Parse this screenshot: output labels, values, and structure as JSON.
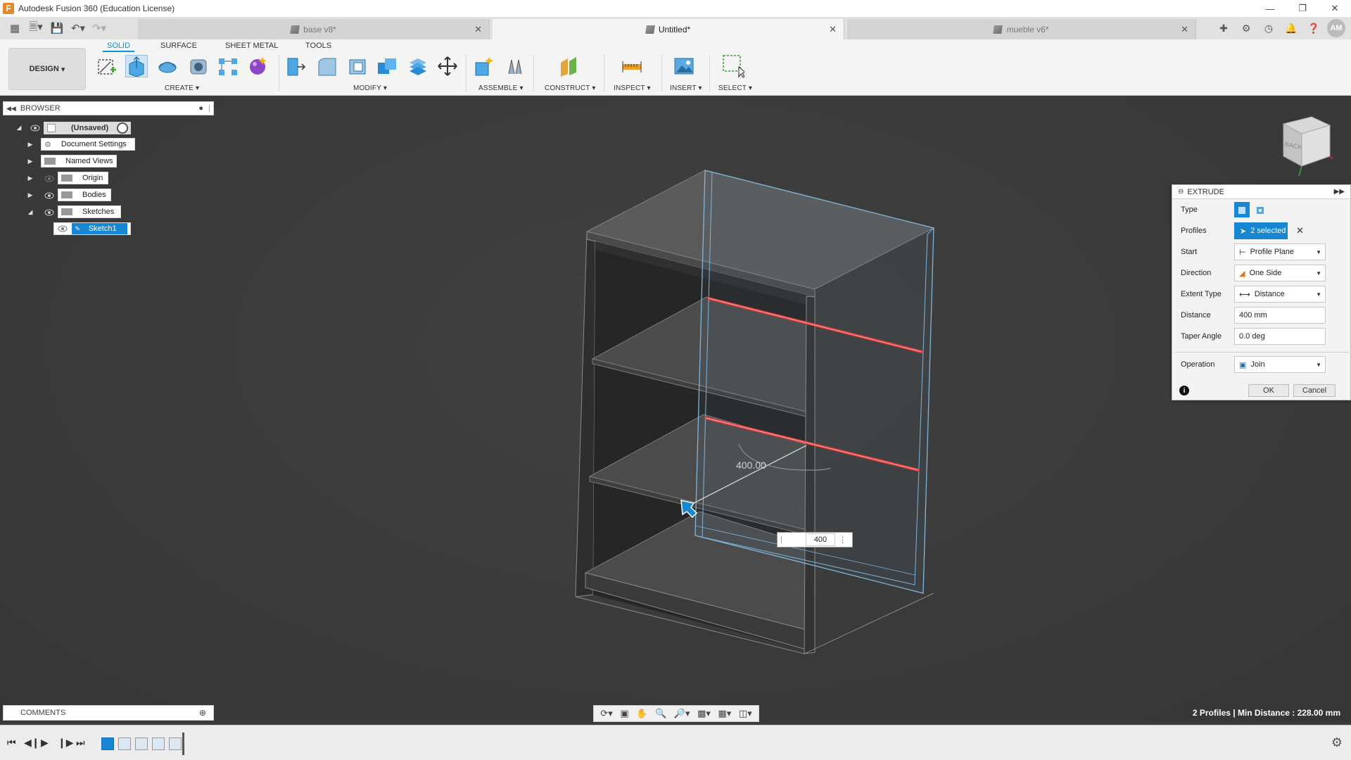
{
  "app": {
    "title": "Autodesk Fusion 360 (Education License)",
    "logo_letter": "F"
  },
  "tabs": [
    {
      "label": "base v8*"
    },
    {
      "label": "Untitled*"
    },
    {
      "label": "mueble v6*"
    }
  ],
  "user": {
    "initials": "AM"
  },
  "toolbar": {
    "workspace": "DESIGN",
    "ribbon_tabs": [
      "SOLID",
      "SURFACE",
      "SHEET METAL",
      "TOOLS"
    ],
    "groups": [
      "CREATE",
      "MODIFY",
      "ASSEMBLE",
      "CONSTRUCT",
      "INSPECT",
      "INSERT",
      "SELECT"
    ]
  },
  "browser": {
    "title": "BROWSER",
    "root": "(Unsaved)",
    "nodes": [
      "Document Settings",
      "Named Views",
      "Origin",
      "Bodies",
      "Sketches",
      "Sketch1"
    ]
  },
  "comments": {
    "title": "COMMENTS"
  },
  "canvas": {
    "dimension_label": "400.00",
    "dimension_input": "400"
  },
  "viewcube": {
    "face": "BACK"
  },
  "status": {
    "text": "2 Profiles | Min Distance : 228.00 mm"
  },
  "extrude": {
    "title": "EXTRUDE",
    "type_label": "Type",
    "profiles_label": "Profiles",
    "profiles_value": "2 selected",
    "start_label": "Start",
    "start_value": "Profile Plane",
    "direction_label": "Direction",
    "direction_value": "One Side",
    "extent_label": "Extent Type",
    "extent_value": "Distance",
    "distance_label": "Distance",
    "distance_value": "400 mm",
    "taper_label": "Taper Angle",
    "taper_value": "0.0 deg",
    "operation_label": "Operation",
    "operation_value": "Join",
    "ok_label": "OK",
    "cancel_label": "Cancel"
  },
  "colors": {
    "accent": "#0696d7",
    "selection_blue": "#1787d4",
    "profile_red": "#e83a3a"
  }
}
